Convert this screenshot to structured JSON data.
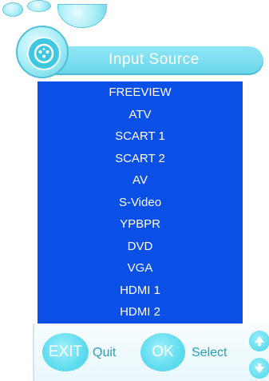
{
  "title": "Input Source",
  "sources": [
    "FREEVIEW",
    "ATV",
    "SCART 1",
    "SCART 2",
    "AV",
    "S-Video",
    "YPBPR",
    "DVD",
    "VGA",
    "HDMI 1",
    "HDMI 2"
  ],
  "footer": {
    "exit_label": "EXIT",
    "quit_label": "Quit",
    "ok_label": "OK",
    "select_label": "Select"
  },
  "icons": {
    "logo": "connector-icon",
    "up": "arrow-up-icon",
    "down": "arrow-down-icon"
  },
  "colors": {
    "list_bg": "#0a4fe6",
    "accent": "#5fdcef",
    "text_on_accent": "#ffffff"
  }
}
